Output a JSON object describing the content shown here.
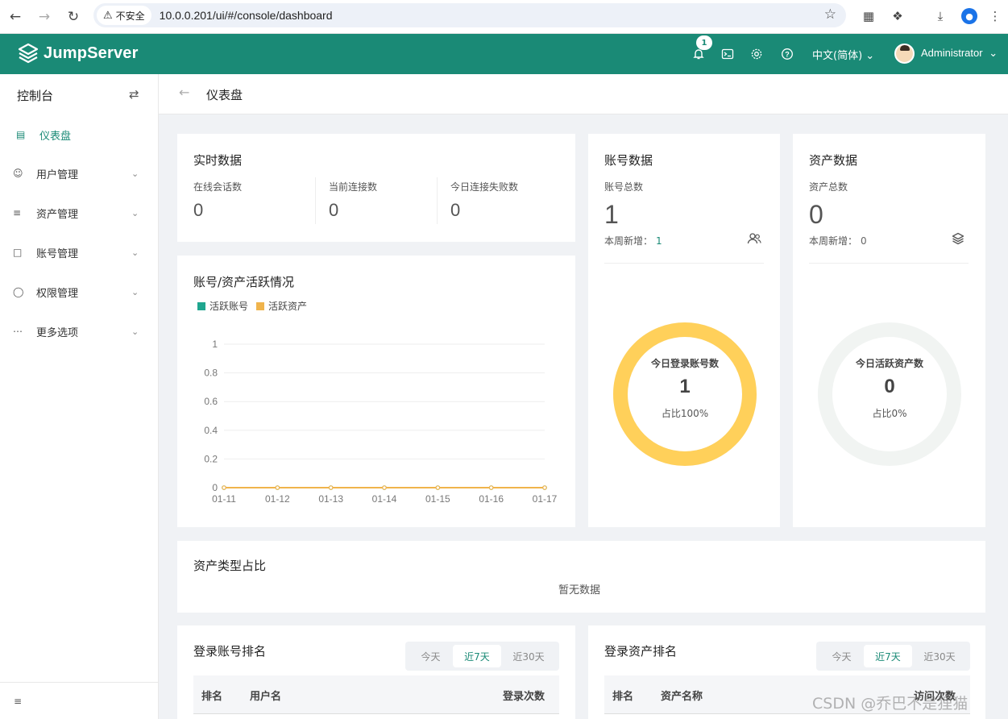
{
  "browser": {
    "security_label": "不安全",
    "url": "10.0.0.201/ui/#/console/dashboard"
  },
  "header": {
    "logo_text": "JumpServer",
    "notification_count": "1",
    "language": "中文(简体)",
    "user": "Administrator",
    "brand_color": "#1a8a76"
  },
  "sidebar": {
    "title": "控制台",
    "items": [
      {
        "label": "仪表盘",
        "icon": "dashboard-icon",
        "active": true
      },
      {
        "label": "用户管理",
        "icon": "users-icon"
      },
      {
        "label": "资产管理",
        "icon": "layers-icon"
      },
      {
        "label": "账号管理",
        "icon": "account-icon"
      },
      {
        "label": "权限管理",
        "icon": "shield-icon"
      },
      {
        "label": "更多选项",
        "icon": "more-icon"
      }
    ]
  },
  "page": {
    "title": "仪表盘"
  },
  "realtime": {
    "title": "实时数据",
    "stats": [
      {
        "label": "在线会话数",
        "value": "0"
      },
      {
        "label": "当前连接数",
        "value": "0"
      },
      {
        "label": "今日连接失败数",
        "value": "0"
      }
    ]
  },
  "accounts": {
    "title": "账号数据",
    "total_label": "账号总数",
    "total": "1",
    "week_label": "本周新增：",
    "week_value": "1",
    "donut_title": "今日登录账号数",
    "donut_value": "1",
    "donut_pct": "占比100%",
    "donut_fraction": 1.0,
    "donut_color": "#ffd05a"
  },
  "assets": {
    "title": "资产数据",
    "total_label": "资产总数",
    "total": "0",
    "week_label": "本周新增：",
    "week_value": "0",
    "donut_title": "今日活跃资产数",
    "donut_value": "0",
    "donut_pct": "占比0%",
    "donut_fraction": 0.0,
    "donut_track_color": "#f1f4f2"
  },
  "activity": {
    "title": "账号/资产活跃情况",
    "legend": [
      {
        "label": "活跃账号",
        "color": "#1fa68f"
      },
      {
        "label": "活跃资产",
        "color": "#f0b44c"
      }
    ]
  },
  "chart_data": {
    "type": "line",
    "x": [
      "01-11",
      "01-12",
      "01-13",
      "01-14",
      "01-15",
      "01-16",
      "01-17"
    ],
    "series": [
      {
        "name": "活跃账号",
        "values": [
          0,
          0,
          0,
          0,
          0,
          0,
          0
        ],
        "color": "#1fa68f"
      },
      {
        "name": "活跃资产",
        "values": [
          0,
          0,
          0,
          0,
          0,
          0,
          0
        ],
        "color": "#f0b44c"
      }
    ],
    "yticks": [
      "0",
      "0.2",
      "0.4",
      "0.6",
      "0.8",
      "1"
    ],
    "ylim": [
      0,
      1
    ],
    "grid": true,
    "legend_position": "top-left"
  },
  "asset_types": {
    "title": "资产类型占比",
    "empty_text": "暂无数据"
  },
  "login_accounts": {
    "title": "登录账号排名",
    "tabs": [
      "今天",
      "近7天",
      "近30天"
    ],
    "selected_tab": 1,
    "columns": [
      "排名",
      "用户名",
      "登录次数"
    ]
  },
  "login_assets": {
    "title": "登录资产排名",
    "tabs": [
      "今天",
      "近7天",
      "近30天"
    ],
    "selected_tab": 1,
    "columns": [
      "排名",
      "资产名称",
      "访问次数"
    ]
  },
  "watermark": "CSDN @乔巴不是狸猫"
}
